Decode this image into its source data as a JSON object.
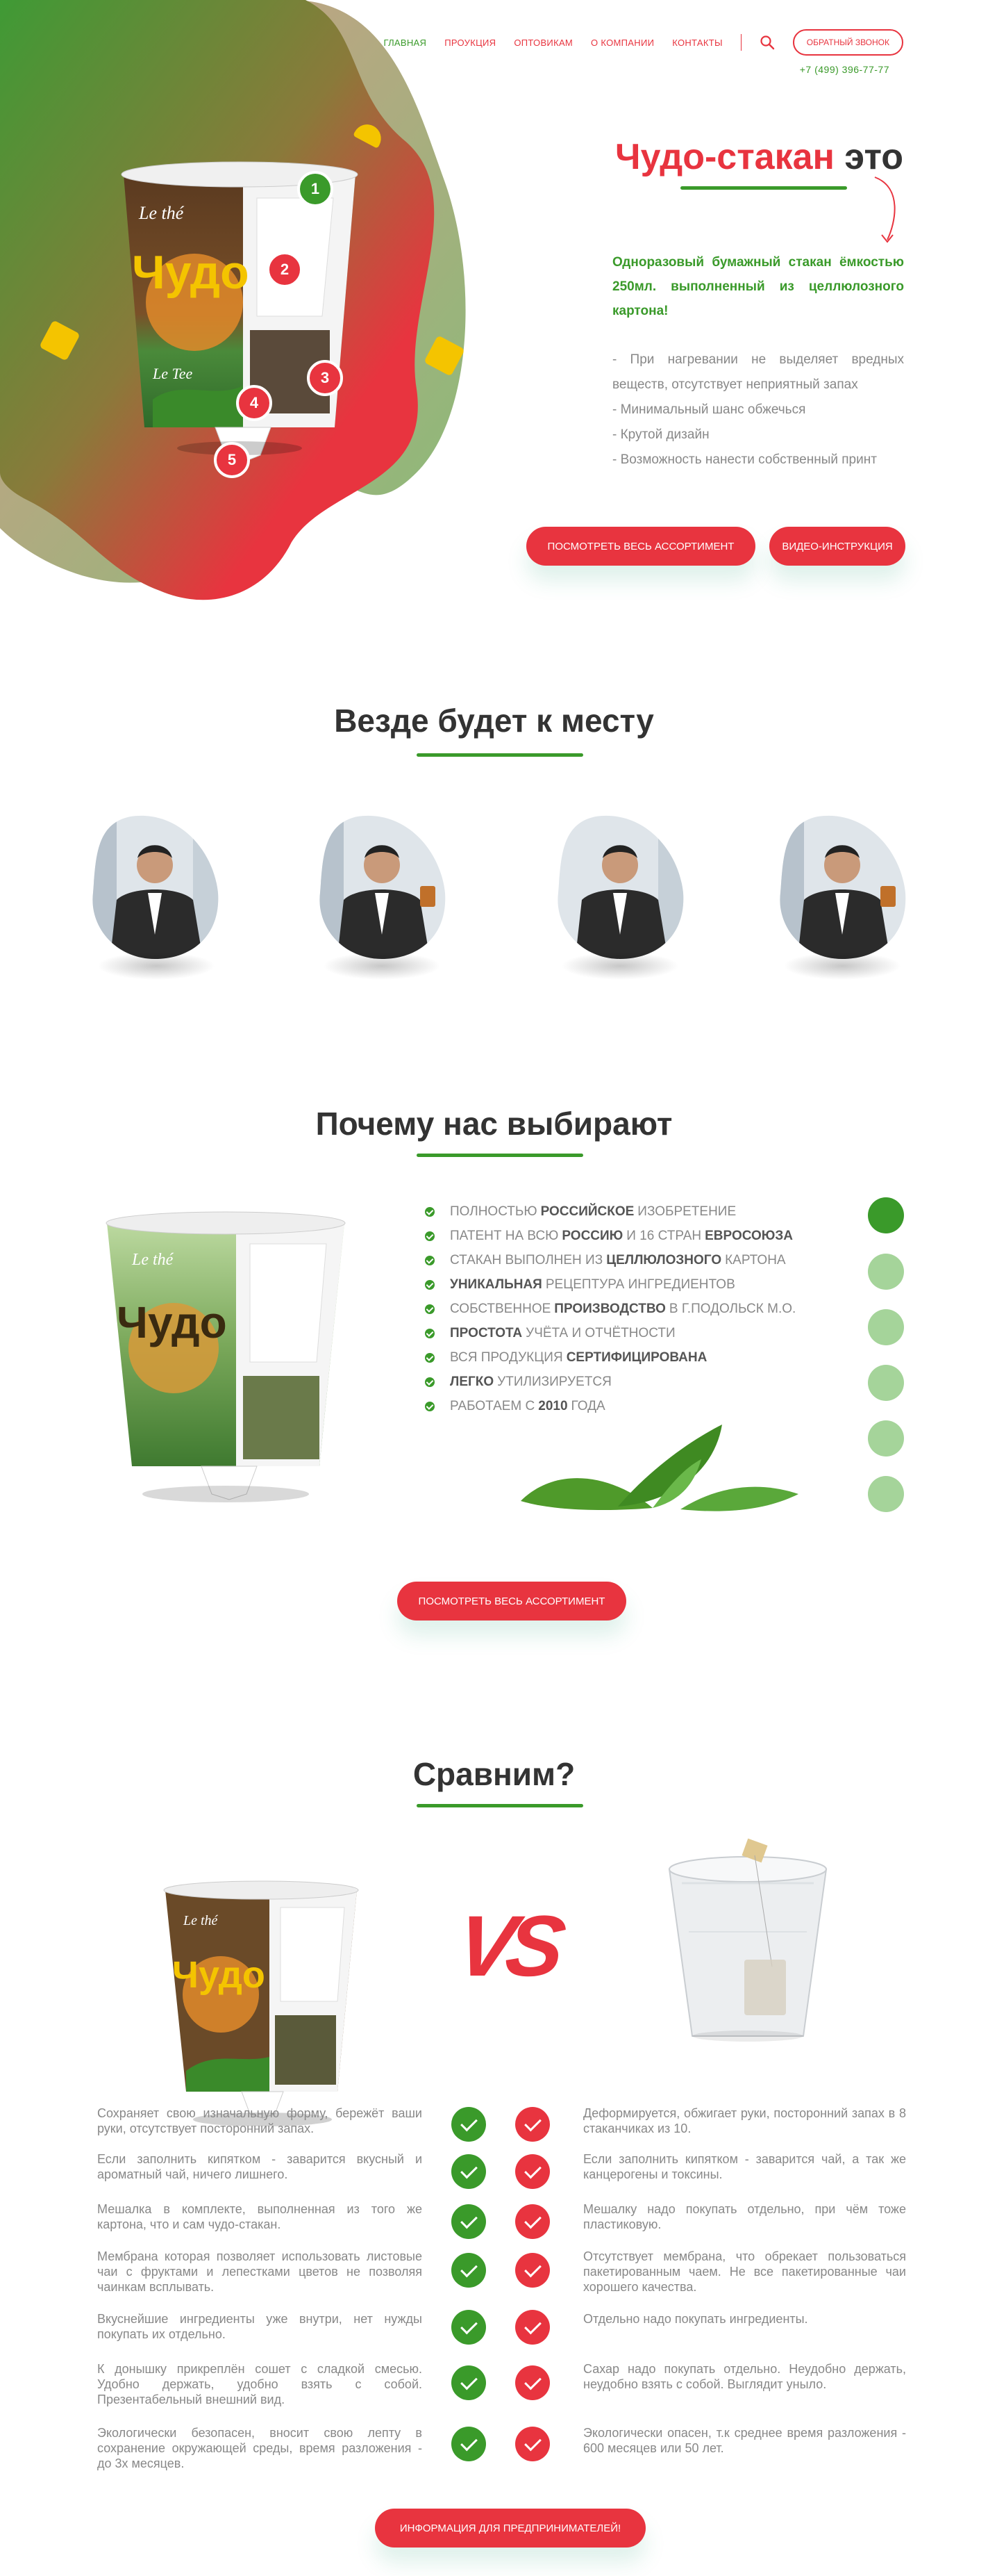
{
  "nav": {
    "items": [
      {
        "label": "ГЛАВНАЯ",
        "active": true
      },
      {
        "label": "ПРОУКЦИЯ",
        "active": false
      },
      {
        "label": "ОПТОВИКАМ",
        "active": false
      },
      {
        "label": "О КОМПАНИИ",
        "active": false
      },
      {
        "label": "КОНТАКТЫ",
        "active": false
      }
    ],
    "search_icon": "search-icon",
    "callback_label": "ОБРАТНЫЙ ЗВОНОК",
    "phone": "+7 (499) 396-77-77"
  },
  "hero": {
    "title_red": "Чудо-стакан",
    "title_dark": "это",
    "lead": "Одноразовый бумажный стакан ёмкостью 250мл. выполненный из целлюлозного картона!",
    "features": [
      "- При нагревании не выделяет вредных веществ, отсутствует неприятный запах",
      "- Минимальный шанс обжечься",
      "- Крутой дизайн",
      "- Возможность нанести собственный принт"
    ],
    "btn_assortment": "ПОСМОТРЕТЬ ВЕСЬ АССОРТИМЕНТ",
    "btn_video": "ВИДЕО-ИНСТРУКЦИЯ",
    "badges": [
      "1",
      "2",
      "3",
      "4",
      "5"
    ],
    "cup_text_top": "Le thé",
    "cup_text_main": "Чудо",
    "cup_text_bottom": "Le Tee"
  },
  "everywhere": {
    "title": "Везде будет к месту"
  },
  "why": {
    "title": "Почему нас выбирают",
    "items": [
      {
        "pre": "ПОЛНОСТЬЮ",
        "bold": "РОССИЙСКОЕ",
        "post": "ИЗОБРЕТЕНИЕ"
      },
      {
        "pre": "ПАТЕНТ НА ВСЮ",
        "bold": "РОССИЮ",
        "post": "И 16 СТРАН",
        "bold2": "ЕВРОСОЮЗА"
      },
      {
        "pre": "СТАКАН ВЫПОЛНЕН ИЗ",
        "bold": "ЦЕЛЛЮЛОЗНОГО",
        "post": "КАРТОНА"
      },
      {
        "pre": "",
        "bold": "УНИКАЛЬНАЯ",
        "post": "РЕЦЕПТУРА ИНГРЕДИЕНТОВ"
      },
      {
        "pre": "СОБСТВЕННОЕ",
        "bold": "ПРОИЗВОДСТВО",
        "post": "В Г.ПОДОЛЬСК М.О."
      },
      {
        "pre": "",
        "bold": "ПРОСТОТА",
        "post": "УЧЁТА И ОТЧЁТНОСТИ"
      },
      {
        "pre": "ВСЯ ПРОДУКЦИЯ",
        "bold": "СЕРТИФИЦИРОВАНА",
        "post": ""
      },
      {
        "pre": "",
        "bold": "ЛЕГКО",
        "post": "УТИЛИЗИРУЕТСЯ"
      },
      {
        "pre": "РАБОТАЕМ С",
        "bold": "2010",
        "post": "ГОДА"
      }
    ],
    "btn_assortment": "ПОСМОТРЕТЬ ВЕСЬ АССОРТИМЕНТ"
  },
  "compare": {
    "title": "Сравним?",
    "vs": "VS",
    "rows": [
      {
        "left": "Сохраняет свою изначальную форму, бережёт ваши руки, отсутствует посторонний запах.",
        "right": "Деформируется, обжигает руки, посторонний запах в 8 стаканчиках из 10."
      },
      {
        "left": "Если заполнить кипятком - заварится вкусный и ароматный чай, ничего лишнего.",
        "right": "Если заполнить кипятком - заварится чай, а так же канцерогены и токсины."
      },
      {
        "left": "Мешалка в комплекте, выполненная из того же картона, что и сам чудо-стакан.",
        "right": "Мешалку надо покупать отдельно, при чём тоже пластиковую."
      },
      {
        "left": "Мембрана которая позволяет использовать листовые чаи с фруктами и лепестками цветов не позволяя чаинкам всплывать.",
        "right": "Отсутствует мембрана, что обрекает пользоваться пакетированным чаем. Не все пакетированные чаи хорошего качества."
      },
      {
        "left": "Вкуснейшие ингредиенты уже внутри, нет нужды покупать их отдельно.",
        "right": "Отдельно надо покупать ингредиенты."
      },
      {
        "left": "К донышку прикреплён сошет с сладкой смесью. Удобно держать, удобно взять с собой. Презентабельный внешний вид.",
        "right": "Сахар надо покупать отдельно. Неудобно держать, неудобно взять с собой. Выглядит уныло."
      },
      {
        "left": "Экологически безопасен, вносит свою лепту в сохранение окружающей среды, время разложения - до 3х месяцев.",
        "right": "Экологически опасен, т.к среднее время разложения - 600 месяцев или 50 лет."
      }
    ],
    "btn_info": "ИНФОРМАЦИЯ ДЛЯ ПРЕДПРИНИМАТЕЛЕЙ!"
  },
  "colors": {
    "brand_red": "#e8343f",
    "brand_green": "#3a9a2a",
    "accent_yellow": "#f4c400"
  }
}
